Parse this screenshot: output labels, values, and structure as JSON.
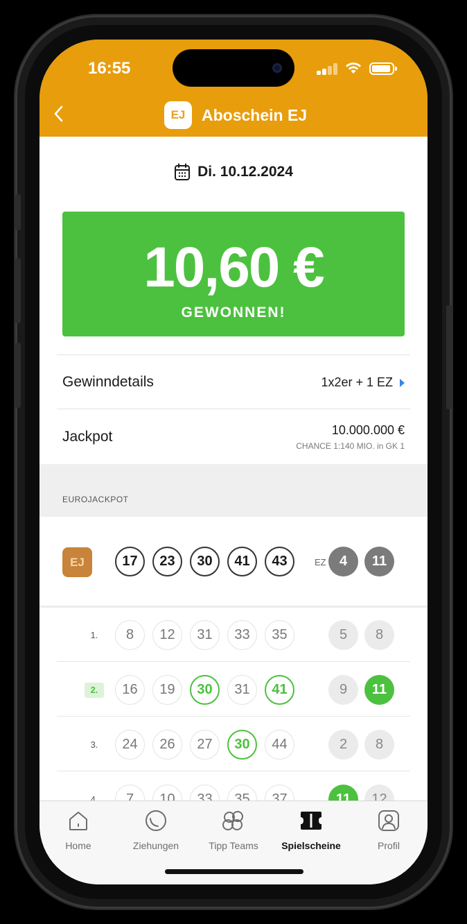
{
  "status_bar": {
    "time": "16:55"
  },
  "header": {
    "title": "Aboschein EJ",
    "logo_text": "EJ",
    "color": "#E89D0C"
  },
  "date": {
    "text": "Di. 10.12.2024"
  },
  "win": {
    "amount": "10,60 €",
    "label": "GEWONNEN!",
    "color": "#4CC13F"
  },
  "details": {
    "gewinn_label": "Gewinndetails",
    "gewinn_value": "1x2er + 1 EZ",
    "jackpot_label": "Jackpot",
    "jackpot_value": "10.000.000 €",
    "jackpot_sub": "CHANCE 1:140 MIO. in GK 1"
  },
  "section": {
    "title": "EUROJACKPOT",
    "logo_text": "EJ",
    "ez_label": "EZ"
  },
  "draw": {
    "numbers": [
      "17",
      "23",
      "30",
      "41",
      "43"
    ],
    "euro": [
      "4",
      "11"
    ]
  },
  "tips": [
    {
      "label": "1.",
      "numbers": [
        "8",
        "12",
        "31",
        "33",
        "35"
      ],
      "euro": [
        "5",
        "8"
      ]
    },
    {
      "label": "2.",
      "numbers": [
        "16",
        "19",
        "30",
        "31",
        "41"
      ],
      "euro": [
        "9",
        "11"
      ]
    },
    {
      "label": "3.",
      "numbers": [
        "24",
        "26",
        "27",
        "30",
        "44"
      ],
      "euro": [
        "2",
        "8"
      ]
    },
    {
      "label": "4.",
      "numbers": [
        "7",
        "10",
        "33",
        "35",
        "37"
      ],
      "euro": [
        "11",
        "12"
      ]
    }
  ],
  "tabbar": {
    "home": "Home",
    "ziehungen": "Ziehungen",
    "tipp_teams": "Tipp Teams",
    "spielscheine": "Spielscheine",
    "profil": "Profil"
  }
}
